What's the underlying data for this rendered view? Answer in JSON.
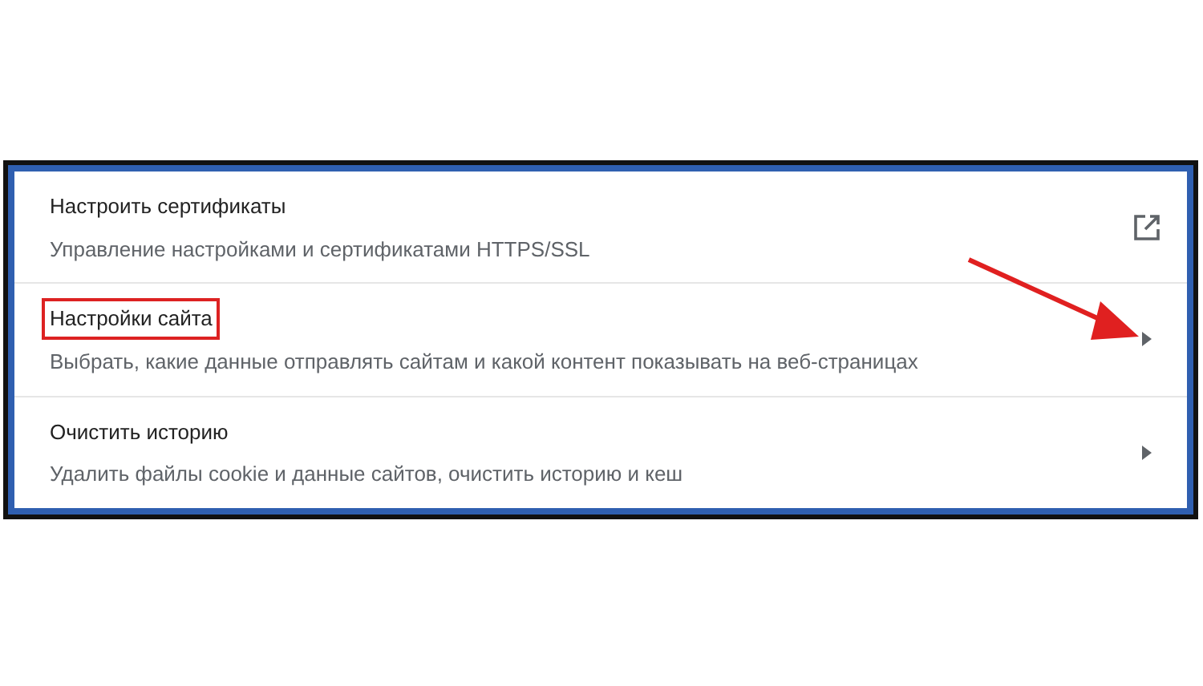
{
  "settings": [
    {
      "title": "Настроить сертификаты",
      "description": "Управление настройками и сертификатами HTTPS/SSL",
      "kind": "external",
      "highlighted": false
    },
    {
      "title": "Настройки сайта",
      "description": "Выбрать, какие данные отправлять сайтам и какой контент показывать на веб-страницах",
      "kind": "submenu",
      "highlighted": true
    },
    {
      "title": "Очистить историю",
      "description": "Удалить файлы cookie и данные сайтов, очистить историю и кеш",
      "kind": "submenu",
      "highlighted": false
    }
  ]
}
